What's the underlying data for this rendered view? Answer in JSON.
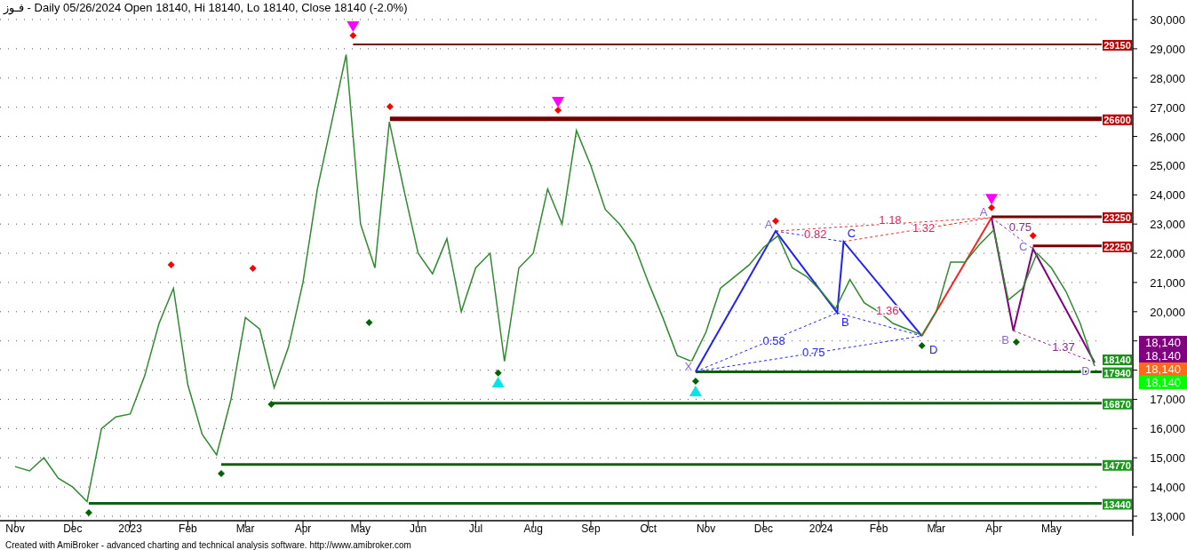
{
  "chart_title": "فـوز - Daily 05/26/2024 Open 18140, Hi 18140, Lo 18140, Close 18140 (-2.0%)",
  "chart_data": {
    "type": "line",
    "categories": [
      "Nov",
      null,
      null,
      null,
      "Dec",
      null,
      null,
      null,
      "2023",
      null,
      null,
      null,
      "Feb",
      null,
      null,
      null,
      "Mar",
      null,
      null,
      null,
      "Apr",
      null,
      null,
      null,
      "May",
      null,
      null,
      null,
      "Jun",
      null,
      null,
      null,
      "Jul",
      null,
      null,
      null,
      "Aug",
      null,
      null,
      null,
      "Sep",
      null,
      null,
      null,
      "Oct",
      null,
      null,
      null,
      "Nov",
      null,
      null,
      null,
      "Dec",
      null,
      null,
      null,
      "2024",
      null,
      null,
      null,
      "Feb",
      null,
      null,
      null,
      "Mar",
      null,
      null,
      null,
      "Apr",
      null,
      null,
      null,
      "May",
      null,
      null,
      null
    ],
    "series": [
      {
        "color": "#2e8b2e",
        "values": [
          14700,
          14550,
          15000,
          14300,
          14000,
          13500,
          16000,
          16400,
          16500,
          17800,
          19600,
          20800,
          17500,
          15800,
          15100,
          17000,
          19800,
          19400,
          17400,
          18800,
          21000,
          24200,
          26500,
          28800,
          23000,
          21500,
          26500,
          24200,
          22000,
          21300,
          22500,
          20000,
          21500,
          22000,
          18300,
          21500,
          22000,
          24200,
          23000,
          26200,
          25000,
          23500,
          23000,
          22300,
          21000,
          19800,
          18500,
          18300,
          19300,
          20800,
          21200,
          21600,
          22200,
          22600,
          21500,
          21200,
          20700,
          20100,
          21100,
          20300,
          20000,
          19600,
          19400,
          19200,
          20000,
          21700,
          21700,
          22300,
          22800,
          20400,
          20800,
          22000,
          21500,
          20700,
          19600,
          18140
        ]
      }
    ],
    "ylim": [
      12847,
      30669
    ],
    "grid": true,
    "ref_lines": [
      {
        "axis": "y",
        "value": 29150,
        "label": "29150",
        "color": "#770000"
      },
      {
        "axis": "y",
        "value": 26600,
        "label": "26600",
        "color": "#770000"
      },
      {
        "axis": "y",
        "value": 23250,
        "label": "23250",
        "color": "#770000"
      },
      {
        "axis": "y",
        "value": 22250,
        "label": "22250",
        "color": "#770000"
      },
      {
        "axis": "y",
        "value": 17940,
        "label": "17940",
        "color": "#106010"
      },
      {
        "axis": "y",
        "value": 16870,
        "label": "16870",
        "color": "#106010"
      },
      {
        "axis": "y",
        "value": 14770,
        "label": "14770",
        "color": "#106010"
      },
      {
        "axis": "y",
        "value": 13440,
        "label": "13440",
        "color": "#106010"
      }
    ],
    "yticks": [
      {
        "value": 13000,
        "label": "13,000"
      },
      {
        "value": 14000,
        "label": "14,000"
      },
      {
        "value": 15000,
        "label": "15,000"
      },
      {
        "value": 16000,
        "label": "16,000"
      },
      {
        "value": 17000,
        "label": "17,000"
      },
      {
        "value": 20000,
        "label": "20,000"
      },
      {
        "value": 21000,
        "label": "21,000"
      },
      {
        "value": 22000,
        "label": "22,000"
      },
      {
        "value": 23000,
        "label": "23,000"
      },
      {
        "value": 24000,
        "label": "24,000"
      },
      {
        "value": 25000,
        "label": "25,000"
      },
      {
        "value": 26000,
        "label": "26,000"
      },
      {
        "value": 27000,
        "label": "27,000"
      },
      {
        "value": 28000,
        "label": "28,000"
      },
      {
        "value": 29000,
        "label": "29,000"
      },
      {
        "value": 30000,
        "label": "30,000"
      }
    ]
  },
  "last_value_tag": {
    "text": "18140",
    "color": "#1a8f1a"
  },
  "ratio_labels": [
    {
      "text": "0.82",
      "color": "#e0205a"
    },
    {
      "text": "0.58",
      "color": "#2020ff"
    },
    {
      "text": "0.75",
      "color": "#2020ff"
    },
    {
      "text": "1.36",
      "color": "#e0205a"
    },
    {
      "text": "1.18",
      "color": "#e0205a"
    },
    {
      "text": "1.32",
      "color": "#e0205a"
    },
    {
      "text": "0.75",
      "color": "#8a2a8a"
    },
    {
      "text": "1.37",
      "color": "#8a2a8a"
    }
  ],
  "point_labels": [
    {
      "text": "X",
      "color": "#8a6ad0"
    },
    {
      "text": "A",
      "color": "#8a6ad0"
    },
    {
      "text": "B",
      "color": "#2020ff"
    },
    {
      "text": "C",
      "color": "#2020ff"
    },
    {
      "text": "D",
      "color": "#2020ff"
    },
    {
      "text": "A",
      "color": "#8a6ad0"
    },
    {
      "text": "B",
      "color": "#8a6ad0"
    },
    {
      "text": "C",
      "color": "#8a6ad0"
    },
    {
      "text": "D",
      "color": "#8a6ad0"
    }
  ],
  "price_tags": [
    {
      "text": "18,140",
      "color": "#800080"
    },
    {
      "text": "18,140",
      "color": "#800080"
    },
    {
      "text": "18,140",
      "color": "#ff6a1a"
    },
    {
      "text": "18,140",
      "color": "#00ff00"
    }
  ],
  "footer": "Created with AmiBroker - advanced charting and technical analysis software. http://www.amibroker.com"
}
